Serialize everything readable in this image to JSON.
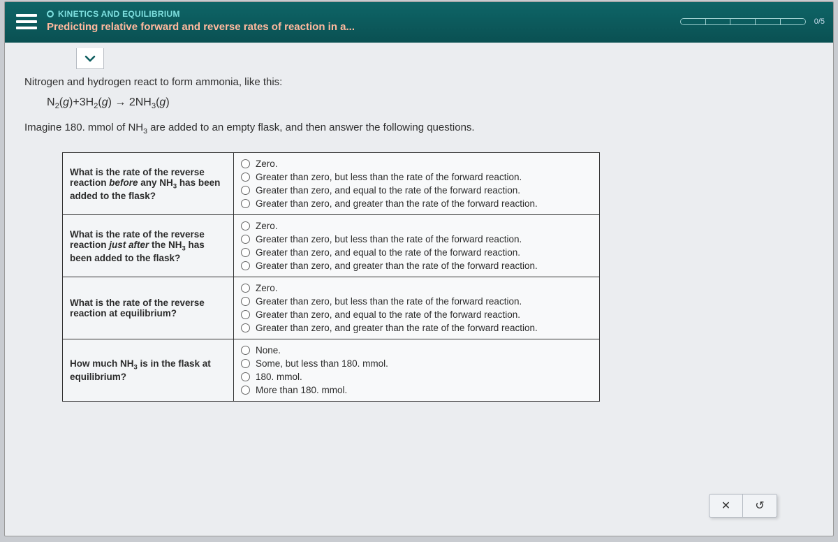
{
  "header": {
    "category": "KINETICS AND EQUILIBRIUM",
    "title": "Predicting relative forward and reverse rates of reaction in a...",
    "progress": "0/5"
  },
  "prompt": {
    "line1": "Nitrogen and hydrogen react to form ammonia, like this:",
    "equation_html": "N<span class='sub'>2</span>(<span class='ital'>g</span>)+3H<span class='sub'>2</span>(<span class='ital'>g</span>) → 2NH<span class='sub'>3</span>(<span class='ital'>g</span>)",
    "line2_pre": "Imagine ",
    "line2_amount": "180.",
    "line2_unit": " mmol",
    "line2_post_html": " of NH<span class='sub'>3</span> are added to an empty flask, and then answer the following questions."
  },
  "option_sets": {
    "rate": [
      "Zero.",
      "Greater than zero, but less than the rate of the forward reaction.",
      "Greater than zero, and equal to the rate of the forward reaction.",
      "Greater than zero, and greater than the rate of the forward reaction."
    ],
    "amount": [
      "None.",
      "Some, but less than 180. mmol.",
      "180. mmol.",
      "More than 180. mmol."
    ]
  },
  "questions": [
    {
      "text_html": "What is the rate of the reverse reaction <span class='ital'>before</span> any NH<span class='sub'>3</span> has been added to the flask?",
      "options": "rate"
    },
    {
      "text_html": "What is the rate of the reverse reaction <span class='ital'>just after</span> the NH<span class='sub'>3</span> has been added to the flask?",
      "options": "rate"
    },
    {
      "text_html": "What is the rate of the reverse reaction at equilibrium?",
      "options": "rate"
    },
    {
      "text_html": "How much NH<span class='sub'>3</span> is in the flask at equilibrium?",
      "options": "amount"
    }
  ],
  "buttons": {
    "clear_symbol": "✕",
    "reset_symbol": "↺"
  }
}
